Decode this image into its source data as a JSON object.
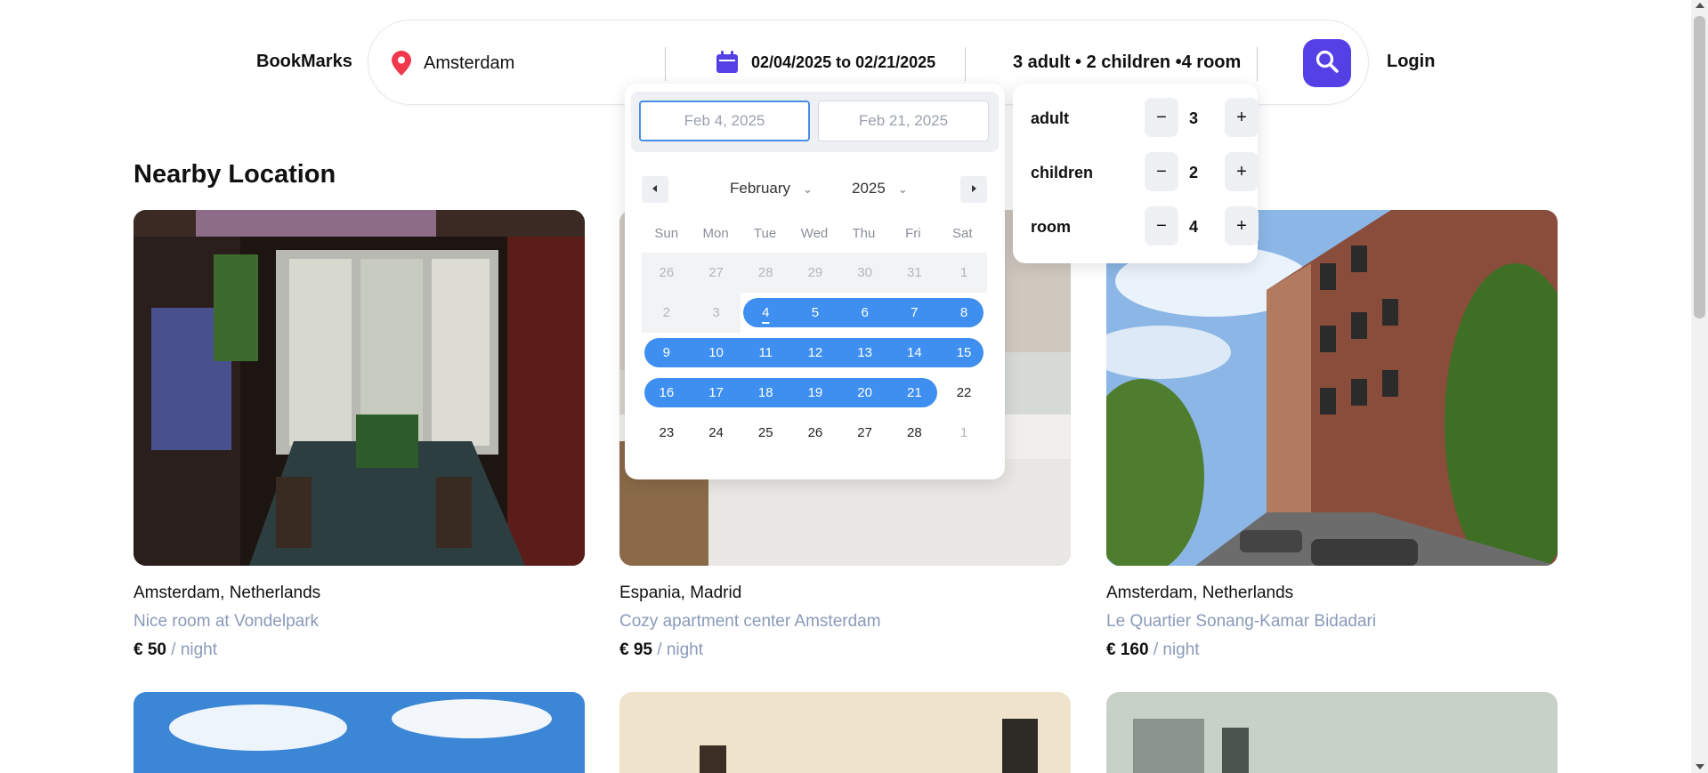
{
  "header": {
    "brand": "BookMarks",
    "login": "Login"
  },
  "search": {
    "location_value": "Amsterdam",
    "date_range": "02/04/2025 to 02/21/2025",
    "guests_summary": "3 adult • 2 children •4 room",
    "pin_icon": "map-pin-icon",
    "calendar_icon": "calendar-icon",
    "search_icon": "search-icon",
    "accent_color": "#5540e6"
  },
  "datepicker": {
    "start_input": "Feb 4, 2025",
    "end_input": "Feb 21, 2025",
    "month": "February",
    "year": "2025",
    "weekdays": [
      "Sun",
      "Mon",
      "Tue",
      "Wed",
      "Thu",
      "Fri",
      "Sat"
    ],
    "weeks": [
      [
        "26",
        "27",
        "28",
        "29",
        "30",
        "31",
        "1"
      ],
      [
        "2",
        "3",
        "4",
        "5",
        "6",
        "7",
        "8"
      ],
      [
        "9",
        "10",
        "11",
        "12",
        "13",
        "14",
        "15"
      ],
      [
        "16",
        "17",
        "18",
        "19",
        "20",
        "21",
        "22"
      ],
      [
        "23",
        "24",
        "25",
        "26",
        "27",
        "28",
        "1"
      ]
    ],
    "range_color": "#3e8fef"
  },
  "guests": {
    "rows": [
      {
        "label": "adult",
        "value": "3"
      },
      {
        "label": "children",
        "value": "2"
      },
      {
        "label": "room",
        "value": "4"
      }
    ],
    "minus": "−",
    "plus": "+"
  },
  "main": {
    "section_title": "Nearby Location",
    "cards": [
      {
        "location": "Amsterdam, Netherlands",
        "name": "Nice room at Vondelpark",
        "price": "€ 50",
        "per": " / night"
      },
      {
        "location": "Espania, Madrid",
        "name": "Cozy apartment center Amsterdam",
        "price": "€ 95",
        "per": " / night"
      },
      {
        "location": "Amsterdam, Netherlands",
        "name": "Le Quartier Sonang-Kamar Bidadari",
        "price": "€ 160",
        "per": " / night"
      }
    ]
  }
}
